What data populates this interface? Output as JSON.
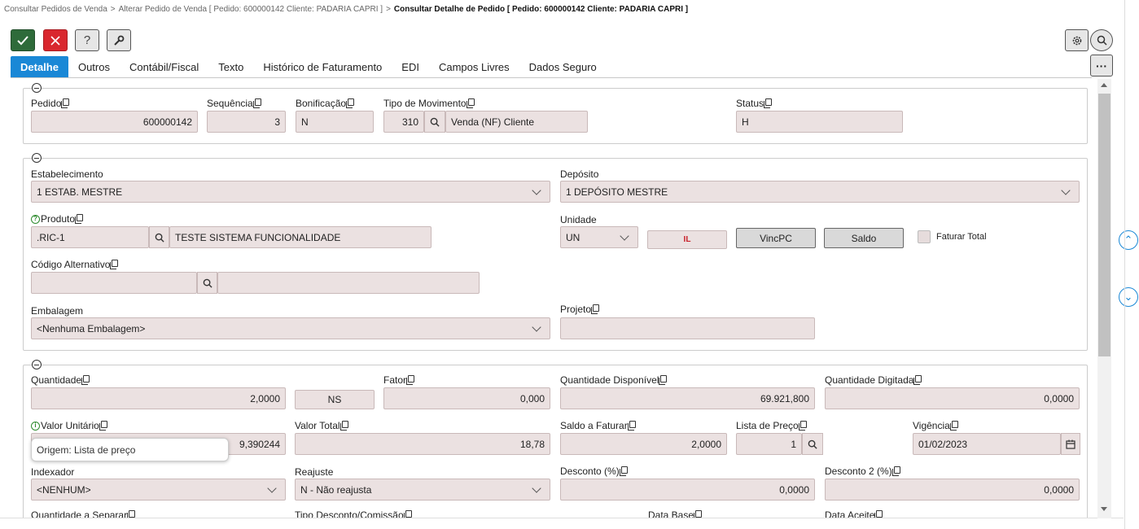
{
  "breadcrumb": {
    "item1": "Consultar Pedidos de Venda",
    "sep": ">",
    "item2": "Alterar Pedido de Venda [ Pedido: 600000142 Cliente: PADARIA CAPRI ]",
    "item3": "Consultar Detalhe de Pedido [ Pedido: 600000142 Cliente: PADARIA CAPRI ]"
  },
  "toolbar": {
    "confirm_icon": "check-icon",
    "cancel_icon": "close-icon",
    "help_label": "?",
    "tools_icon": "wrench-icon",
    "settings_icon": "gear-icon",
    "search_icon": "search-icon",
    "more_label": "···"
  },
  "tabs": [
    "Detalhe",
    "Outros",
    "Contábil/Fiscal",
    "Texto",
    "Histórico de Faturamento",
    "EDI",
    "Campos Livres",
    "Dados Seguro"
  ],
  "section1": {
    "pedido_label": "Pedido",
    "pedido_value": "600000142",
    "sequencia_label": "Sequência",
    "sequencia_value": "3",
    "bonificacao_label": "Bonificação",
    "bonificacao_value": "N",
    "tipo_mov_label": "Tipo de Movimento",
    "tipo_mov_code": "310",
    "tipo_mov_desc": "Venda (NF) Cliente",
    "status_label": "Status",
    "status_value": "H"
  },
  "section2": {
    "estab_label": "Estabelecimento",
    "estab_value": "1 ESTAB. MESTRE",
    "deposito_label": "Depósito",
    "deposito_value": "1 DEPÓSITO MESTRE",
    "produto_label": "Produto",
    "produto_code": ".RIC-1",
    "produto_desc": "TESTE SISTEMA FUNCIONALIDADE",
    "unidade_label": "Unidade",
    "unidade_value": "UN",
    "il_button": "IL",
    "vincpc_button": "VincPC",
    "saldo_button": "Saldo",
    "faturar_total_label": "Faturar Total",
    "cod_alt_label": "Código Alternativo",
    "cod_alt_value": "",
    "cod_alt_desc": "",
    "embalagem_label": "Embalagem",
    "embalagem_value": "<Nenhuma Embalagem>",
    "projeto_label": "Projeto",
    "projeto_value": ""
  },
  "section3": {
    "quantidade_label": "Quantidade",
    "quantidade_value": "2,0000",
    "ns_value": "NS",
    "fator_label": "Fator",
    "fator_value": "0,000",
    "qtd_disp_label": "Quantidade Disponível",
    "qtd_disp_value": "69.921,800",
    "qtd_dig_label": "Quantidade Digitada",
    "qtd_dig_value": "0,0000",
    "valor_unit_label": "Valor Unitário",
    "valor_unit_value": "9,390244",
    "valor_total_label": "Valor Total",
    "valor_total_value": "18,78",
    "saldo_fat_label": "Saldo a Faturar",
    "saldo_fat_value": "2,0000",
    "lista_preco_label": "Lista de Preço",
    "lista_preco_value": "1",
    "vigencia_label": "Vigência",
    "vigencia_value": "01/02/2023",
    "indexador_label": "Indexador",
    "indexador_value": "<NENHUM>",
    "reajuste_label": "Reajuste",
    "reajuste_value": "N - Não reajusta",
    "desconto_label": "Desconto (%)",
    "desconto_value": "0,0000",
    "desconto2_label": "Desconto 2 (%)",
    "desconto2_value": "0,0000",
    "qtd_sep_label": "Quantidade a Separar",
    "tipo_desc_label": "Tipo Desconto/Comissão",
    "data_base_label": "Data Base",
    "data_aceite_label": "Data Aceite"
  },
  "tooltip": "Origem: Lista de preço",
  "colors": {
    "accent": "#1a88d6",
    "confirm": "#2e6b3a",
    "cancel": "#d9272e",
    "field_bg": "#ebe1e1"
  }
}
